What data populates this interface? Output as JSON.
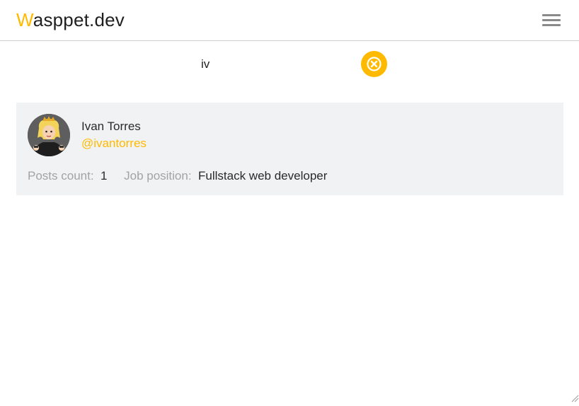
{
  "header": {
    "logo_first": "W",
    "logo_rest": "asppet.dev",
    "menu_icon": "hamburger-menu-icon"
  },
  "search": {
    "value": "iv",
    "placeholder": "",
    "clear_icon": "close-circle-icon"
  },
  "results": [
    {
      "name": "Ivan Torres",
      "handle": "@ivantorres",
      "posts_count_label": "Posts count:",
      "posts_count": "1",
      "job_position_label": "Job position:",
      "job_position": "Fullstack web developer"
    }
  ],
  "colors": {
    "accent": "#ffba00",
    "card_bg": "#f1f2f4",
    "muted_text": "#a3a3a3"
  }
}
